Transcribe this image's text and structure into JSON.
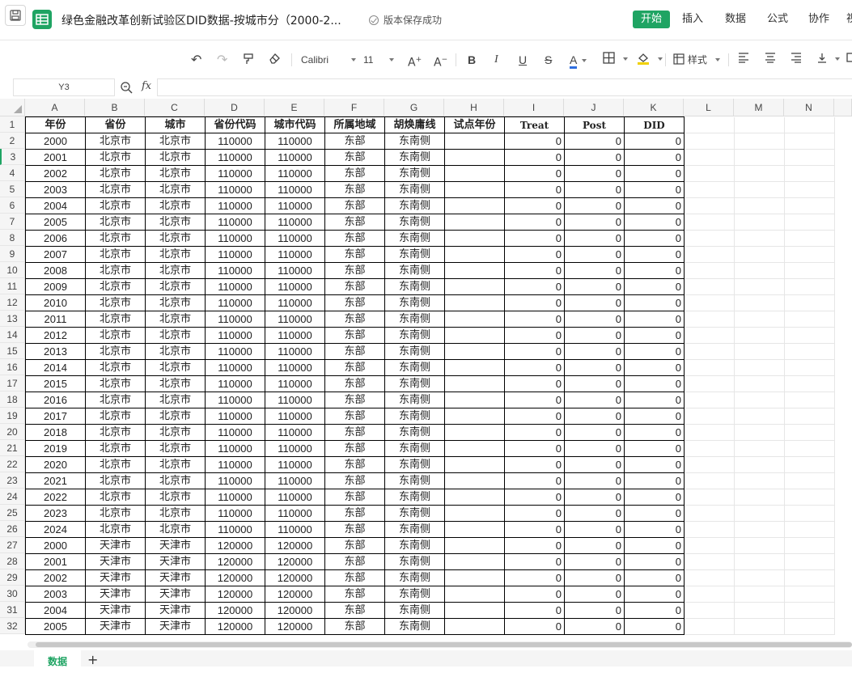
{
  "titlebar": {
    "doc_title": "绿色金融改革创新试验区DID数据-按城市分（2000-2...",
    "save_status": "版本保存成功",
    "menus": [
      "开始",
      "插入",
      "数据",
      "公式",
      "协作",
      "视"
    ]
  },
  "toolbar": {
    "font_name": "Calibri",
    "font_size": "11",
    "style_label": "样式",
    "accent_color": "#1fa463",
    "font_color_bar": "#2f6fe0",
    "fill_color_bar": "#f0d000"
  },
  "formula": {
    "cell_ref": "Y3",
    "fx": "fx"
  },
  "columns": [
    "A",
    "B",
    "C",
    "D",
    "E",
    "F",
    "G",
    "H",
    "I",
    "J",
    "K",
    "L",
    "M",
    "N"
  ],
  "headers": [
    "年份",
    "省份",
    "城市",
    "省份代码",
    "城市代码",
    "所属地域",
    "胡焕庸线",
    "试点年份",
    "Treat",
    "Post",
    "DID"
  ],
  "rows": [
    [
      "2000",
      "北京市",
      "北京市",
      "110000",
      "110000",
      "东部",
      "东南侧",
      "",
      "0",
      "0",
      "0"
    ],
    [
      "2001",
      "北京市",
      "北京市",
      "110000",
      "110000",
      "东部",
      "东南侧",
      "",
      "0",
      "0",
      "0"
    ],
    [
      "2002",
      "北京市",
      "北京市",
      "110000",
      "110000",
      "东部",
      "东南侧",
      "",
      "0",
      "0",
      "0"
    ],
    [
      "2003",
      "北京市",
      "北京市",
      "110000",
      "110000",
      "东部",
      "东南侧",
      "",
      "0",
      "0",
      "0"
    ],
    [
      "2004",
      "北京市",
      "北京市",
      "110000",
      "110000",
      "东部",
      "东南侧",
      "",
      "0",
      "0",
      "0"
    ],
    [
      "2005",
      "北京市",
      "北京市",
      "110000",
      "110000",
      "东部",
      "东南侧",
      "",
      "0",
      "0",
      "0"
    ],
    [
      "2006",
      "北京市",
      "北京市",
      "110000",
      "110000",
      "东部",
      "东南侧",
      "",
      "0",
      "0",
      "0"
    ],
    [
      "2007",
      "北京市",
      "北京市",
      "110000",
      "110000",
      "东部",
      "东南侧",
      "",
      "0",
      "0",
      "0"
    ],
    [
      "2008",
      "北京市",
      "北京市",
      "110000",
      "110000",
      "东部",
      "东南侧",
      "",
      "0",
      "0",
      "0"
    ],
    [
      "2009",
      "北京市",
      "北京市",
      "110000",
      "110000",
      "东部",
      "东南侧",
      "",
      "0",
      "0",
      "0"
    ],
    [
      "2010",
      "北京市",
      "北京市",
      "110000",
      "110000",
      "东部",
      "东南侧",
      "",
      "0",
      "0",
      "0"
    ],
    [
      "2011",
      "北京市",
      "北京市",
      "110000",
      "110000",
      "东部",
      "东南侧",
      "",
      "0",
      "0",
      "0"
    ],
    [
      "2012",
      "北京市",
      "北京市",
      "110000",
      "110000",
      "东部",
      "东南侧",
      "",
      "0",
      "0",
      "0"
    ],
    [
      "2013",
      "北京市",
      "北京市",
      "110000",
      "110000",
      "东部",
      "东南侧",
      "",
      "0",
      "0",
      "0"
    ],
    [
      "2014",
      "北京市",
      "北京市",
      "110000",
      "110000",
      "东部",
      "东南侧",
      "",
      "0",
      "0",
      "0"
    ],
    [
      "2015",
      "北京市",
      "北京市",
      "110000",
      "110000",
      "东部",
      "东南侧",
      "",
      "0",
      "0",
      "0"
    ],
    [
      "2016",
      "北京市",
      "北京市",
      "110000",
      "110000",
      "东部",
      "东南侧",
      "",
      "0",
      "0",
      "0"
    ],
    [
      "2017",
      "北京市",
      "北京市",
      "110000",
      "110000",
      "东部",
      "东南侧",
      "",
      "0",
      "0",
      "0"
    ],
    [
      "2018",
      "北京市",
      "北京市",
      "110000",
      "110000",
      "东部",
      "东南侧",
      "",
      "0",
      "0",
      "0"
    ],
    [
      "2019",
      "北京市",
      "北京市",
      "110000",
      "110000",
      "东部",
      "东南侧",
      "",
      "0",
      "0",
      "0"
    ],
    [
      "2020",
      "北京市",
      "北京市",
      "110000",
      "110000",
      "东部",
      "东南侧",
      "",
      "0",
      "0",
      "0"
    ],
    [
      "2021",
      "北京市",
      "北京市",
      "110000",
      "110000",
      "东部",
      "东南侧",
      "",
      "0",
      "0",
      "0"
    ],
    [
      "2022",
      "北京市",
      "北京市",
      "110000",
      "110000",
      "东部",
      "东南侧",
      "",
      "0",
      "0",
      "0"
    ],
    [
      "2023",
      "北京市",
      "北京市",
      "110000",
      "110000",
      "东部",
      "东南侧",
      "",
      "0",
      "0",
      "0"
    ],
    [
      "2024",
      "北京市",
      "北京市",
      "110000",
      "110000",
      "东部",
      "东南侧",
      "",
      "0",
      "0",
      "0"
    ],
    [
      "2000",
      "天津市",
      "天津市",
      "120000",
      "120000",
      "东部",
      "东南侧",
      "",
      "0",
      "0",
      "0"
    ],
    [
      "2001",
      "天津市",
      "天津市",
      "120000",
      "120000",
      "东部",
      "东南侧",
      "",
      "0",
      "0",
      "0"
    ],
    [
      "2002",
      "天津市",
      "天津市",
      "120000",
      "120000",
      "东部",
      "东南侧",
      "",
      "0",
      "0",
      "0"
    ],
    [
      "2003",
      "天津市",
      "天津市",
      "120000",
      "120000",
      "东部",
      "东南侧",
      "",
      "0",
      "0",
      "0"
    ],
    [
      "2004",
      "天津市",
      "天津市",
      "120000",
      "120000",
      "东部",
      "东南侧",
      "",
      "0",
      "0",
      "0"
    ],
    [
      "2005",
      "天津市",
      "天津市",
      "120000",
      "120000",
      "东部",
      "东南侧",
      "",
      "0",
      "0",
      "0"
    ]
  ],
  "sheet_tabs": [
    "数据"
  ],
  "add_sheet": "+"
}
